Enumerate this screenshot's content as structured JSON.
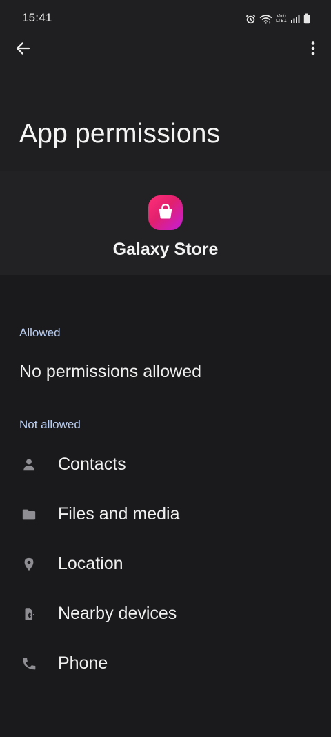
{
  "status_bar": {
    "time": "15:41",
    "icons": [
      "alarm-icon",
      "wifi-icon",
      "volte-icon",
      "signal-icon",
      "battery-icon"
    ],
    "volte_top": "Vo))",
    "volte_bottom": "LTE1"
  },
  "toolbar": {
    "back_icon": "arrow-left-icon",
    "more_icon": "more-vertical-icon"
  },
  "page": {
    "title": "App permissions"
  },
  "app": {
    "name": "Galaxy Store",
    "icon": "shopping-bag-icon",
    "icon_gradient": [
      "#ff2f78",
      "#c51ed9"
    ]
  },
  "sections": {
    "allowed": {
      "label": "Allowed",
      "empty_text": "No permissions allowed"
    },
    "not_allowed": {
      "label": "Not allowed",
      "items": [
        {
          "label": "Contacts",
          "icon": "person-icon"
        },
        {
          "label": "Files and media",
          "icon": "folder-icon"
        },
        {
          "label": "Location",
          "icon": "location-pin-icon"
        },
        {
          "label": "Nearby devices",
          "icon": "nearby-devices-icon"
        },
        {
          "label": "Phone",
          "icon": "phone-icon"
        }
      ]
    }
  },
  "colors": {
    "background": "#1a1a1c",
    "header_background": "#1f1f21",
    "card_background": "#222224",
    "section_label": "#b8cdf2",
    "icon_gray": "#8e8e93",
    "text": "#f0f0f0"
  }
}
